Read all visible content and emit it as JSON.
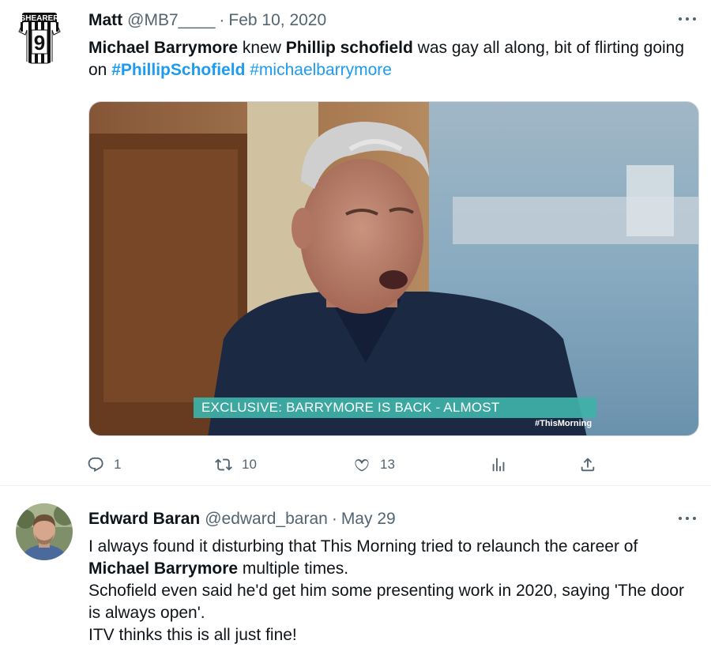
{
  "tweets": [
    {
      "author_name": "Matt",
      "handle": "@MB7____",
      "separator": "·",
      "date": "Feb 10, 2020",
      "avatar_icon": "newcastle-shirt-9-avatar",
      "avatar_text": "SHEARER",
      "text": {
        "p1_bold": "Michael Barrymore",
        "p1": " knew ",
        "p2_bold": "Phillip schofield",
        "p2": " was gay all along, bit of flirting going on  ",
        "hashtag1": "#PhillipSchofield",
        "hashtag2": "#michaelbarrymore"
      },
      "media": {
        "banner_text": "EXCLUSIVE: BARRYMORE IS BACK - ALMOST",
        "tag_text": "#ThisMorning"
      },
      "actions": {
        "replies": "1",
        "retweets": "10",
        "likes": "13"
      }
    },
    {
      "author_name": "Edward Baran",
      "handle": "@edward_baran",
      "separator": "·",
      "date": "May 29",
      "avatar_icon": "profile-photo-avatar",
      "text": {
        "l1": "I always found it disturbing that This Morning tried to relaunch the career of ",
        "l1_bold": "Michael Barrymore",
        "l1_end": " multiple times.",
        "l2": "Schofield even said he'd get him some presenting work in 2020, saying 'The door is always open'.",
        "l3": "ITV thinks this is all just fine!"
      }
    }
  ],
  "colors": {
    "text": "#0f1419",
    "secondary": "#536471",
    "accent": "#1d9bf0",
    "divider": "#eff3f4"
  }
}
